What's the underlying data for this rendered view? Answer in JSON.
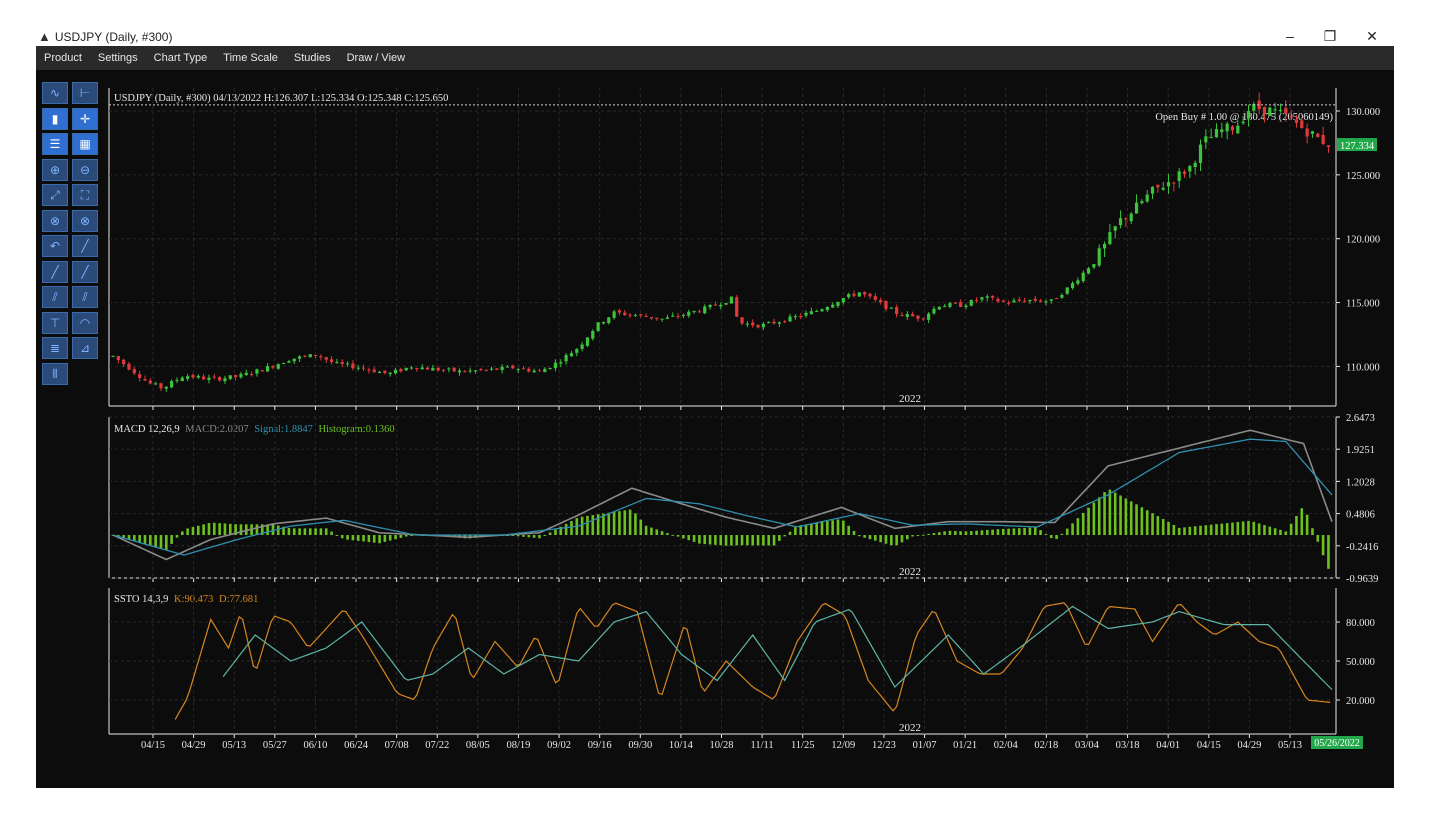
{
  "window": {
    "title": "USDJPY (Daily, #300)",
    "minimize_glyph": "–",
    "restore_glyph": "❐",
    "close_glyph": "✕"
  },
  "menu": [
    "Product",
    "Settings",
    "Chart Type",
    "Time Scale",
    "Studies",
    "Draw / View"
  ],
  "toolbar": {
    "buttons": [
      {
        "icon": "line-chart-icon",
        "active": false
      },
      {
        "icon": "ohlc-bars-icon",
        "active": false
      },
      {
        "icon": "candlestick-icon",
        "active": true
      },
      {
        "icon": "crosshair-icon",
        "active": true
      },
      {
        "icon": "horizontal-lines-icon",
        "active": true
      },
      {
        "icon": "grid-dots-icon",
        "active": true
      },
      {
        "icon": "zoom-in-icon",
        "active": false
      },
      {
        "icon": "zoom-out-icon",
        "active": false
      },
      {
        "icon": "zoom-fit-icon",
        "active": false
      },
      {
        "icon": "fullscreen-icon",
        "active": false
      },
      {
        "icon": "delete-drawing-icon",
        "active": false
      },
      {
        "icon": "delete-all-icon",
        "active": false
      },
      {
        "icon": "undo-icon",
        "active": false
      },
      {
        "icon": "trendline-icon",
        "active": false
      },
      {
        "icon": "ray-icon",
        "active": false
      },
      {
        "icon": "extended-line-icon",
        "active": false
      },
      {
        "icon": "channel-icon",
        "active": false
      },
      {
        "icon": "parallel-lines-icon",
        "active": false
      },
      {
        "icon": "horizontal-ray-icon",
        "active": false
      },
      {
        "icon": "fibonacci-arc-icon",
        "active": false
      },
      {
        "icon": "fibonacci-retracement-icon",
        "active": false
      },
      {
        "icon": "gann-fan-icon",
        "active": false
      },
      {
        "icon": "vertical-lines-icon",
        "active": false
      }
    ]
  },
  "colors": {
    "background": "#0c0c0c",
    "grid": "#2a2a2a",
    "up": "#3cc43c",
    "down": "#e03a3a",
    "macd": "#8a8a8a",
    "signal": "#2f8fb0",
    "histogram": "#6bc21f",
    "stoch_k": "#d7861f",
    "stoch_d": "#5fb5a8",
    "price_tag": "#22a84a"
  },
  "price_panel": {
    "header": "USDJPY (Daily, #300)  04/13/2022 H:126.307 L:125.334 O:125.348 C:125.650",
    "order_label": "Open Buy # 1.00 @ 130.475 (205060149)",
    "order_price": 130.475,
    "last_price_tag": "127.334",
    "last_price": 127.334,
    "year_label": "2022",
    "y_ticks": [
      "130.000",
      "125.000",
      "120.000",
      "115.000",
      "110.000"
    ]
  },
  "macd_panel": {
    "header_name": "MACD 12,26,9",
    "header_macd": "MACD:2.0207",
    "header_signal": "Signal:1.8847",
    "header_hist": "Histogram:0.1360",
    "year_label": "2022",
    "y_ticks": [
      "2.6473",
      "1.9251",
      "1.2028",
      "0.4806",
      "-0.2416",
      "-0.9639"
    ]
  },
  "stoch_panel": {
    "header_name": "SSTO 14,3,9",
    "header_k": "K:90.473",
    "header_d": "D:77.681",
    "year_label": "2022",
    "y_ticks": [
      "80.000",
      "50.000",
      "20.000"
    ]
  },
  "x_axis": {
    "labels": [
      "04/15",
      "04/29",
      "05/13",
      "05/27",
      "06/10",
      "06/24",
      "07/08",
      "07/22",
      "08/05",
      "08/19",
      "09/02",
      "09/16",
      "09/30",
      "10/14",
      "10/28",
      "11/11",
      "11/25",
      "12/09",
      "12/23",
      "01/07",
      "01/21",
      "02/04",
      "02/18",
      "03/04",
      "03/18",
      "04/01",
      "04/15",
      "04/29",
      "05/13"
    ],
    "last_date_tag": "05/26/2022"
  },
  "chart_data": {
    "type": "candlestick",
    "symbol": "USDJPY",
    "timeframe": "Daily",
    "price_series_approx": [
      [
        0,
        110.8
      ],
      [
        10,
        109.8
      ],
      [
        20,
        108.7
      ],
      [
        28,
        108.3
      ],
      [
        40,
        109.3
      ],
      [
        55,
        109.0
      ],
      [
        70,
        109.2
      ],
      [
        85,
        109.8
      ],
      [
        100,
        110.6
      ],
      [
        115,
        110.9
      ],
      [
        125,
        110.2
      ],
      [
        140,
        109.9
      ],
      [
        155,
        109.4
      ],
      [
        168,
        110.0
      ],
      [
        180,
        109.8
      ],
      [
        195,
        109.6
      ],
      [
        210,
        109.7
      ],
      [
        225,
        109.9
      ],
      [
        240,
        109.6
      ],
      [
        250,
        110.3
      ],
      [
        262,
        111.5
      ],
      [
        272,
        113.2
      ],
      [
        282,
        114.2
      ],
      [
        295,
        114.0
      ],
      [
        310,
        113.7
      ],
      [
        322,
        114.1
      ],
      [
        335,
        114.6
      ],
      [
        348,
        115.3
      ],
      [
        352,
        113.4
      ],
      [
        365,
        113.2
      ],
      [
        380,
        113.7
      ],
      [
        395,
        114.3
      ],
      [
        410,
        115.3
      ],
      [
        420,
        115.8
      ],
      [
        432,
        114.9
      ],
      [
        442,
        114.1
      ],
      [
        455,
        113.8
      ],
      [
        465,
        114.8
      ],
      [
        478,
        114.8
      ],
      [
        490,
        115.4
      ],
      [
        502,
        115.0
      ],
      [
        515,
        115.2
      ],
      [
        528,
        115.1
      ],
      [
        538,
        116.2
      ],
      [
        548,
        117.6
      ],
      [
        558,
        119.4
      ],
      [
        566,
        121.3
      ],
      [
        574,
        122.2
      ],
      [
        584,
        123.6
      ],
      [
        596,
        124.6
      ],
      [
        606,
        125.6
      ],
      [
        614,
        127.6
      ],
      [
        624,
        128.5
      ],
      [
        632,
        128.8
      ],
      [
        640,
        130.3
      ],
      [
        650,
        130.1
      ],
      [
        660,
        129.6
      ],
      [
        670,
        128.6
      ],
      [
        680,
        127.7
      ],
      [
        686,
        127.3
      ]
    ],
    "macd_series_approx": {
      "macd": [
        [
          0,
          0.0
        ],
        [
          30,
          -0.55
        ],
        [
          55,
          -0.1
        ],
        [
          90,
          0.25
        ],
        [
          120,
          0.38
        ],
        [
          150,
          0.05
        ],
        [
          200,
          -0.05
        ],
        [
          240,
          0.05
        ],
        [
          262,
          0.45
        ],
        [
          292,
          1.05
        ],
        [
          320,
          0.7
        ],
        [
          345,
          0.4
        ],
        [
          372,
          0.15
        ],
        [
          410,
          0.62
        ],
        [
          440,
          0.15
        ],
        [
          470,
          0.3
        ],
        [
          500,
          0.3
        ],
        [
          530,
          0.28
        ],
        [
          560,
          1.55
        ],
        [
          610,
          2.05
        ],
        [
          640,
          2.35
        ],
        [
          670,
          2.05
        ],
        [
          686,
          0.3
        ]
      ],
      "signal": [
        [
          0,
          0.0
        ],
        [
          40,
          -0.45
        ],
        [
          70,
          -0.1
        ],
        [
          100,
          0.2
        ],
        [
          130,
          0.33
        ],
        [
          170,
          0.0
        ],
        [
          220,
          0.0
        ],
        [
          262,
          0.2
        ],
        [
          300,
          0.82
        ],
        [
          330,
          0.7
        ],
        [
          355,
          0.45
        ],
        [
          385,
          0.18
        ],
        [
          420,
          0.48
        ],
        [
          450,
          0.22
        ],
        [
          480,
          0.25
        ],
        [
          520,
          0.18
        ],
        [
          560,
          0.9
        ],
        [
          600,
          1.85
        ],
        [
          640,
          2.15
        ],
        [
          660,
          2.1
        ],
        [
          686,
          0.9
        ]
      ]
    },
    "stoch_series_approx": {
      "k": [
        [
          35,
          5
        ],
        [
          42,
          22
        ],
        [
          55,
          82
        ],
        [
          65,
          60
        ],
        [
          72,
          88
        ],
        [
          80,
          40
        ],
        [
          90,
          85
        ],
        [
          100,
          80
        ],
        [
          110,
          60
        ],
        [
          120,
          75
        ],
        [
          130,
          90
        ],
        [
          140,
          70
        ],
        [
          160,
          25
        ],
        [
          170,
          20
        ],
        [
          180,
          60
        ],
        [
          192,
          88
        ],
        [
          202,
          35
        ],
        [
          215,
          65
        ],
        [
          228,
          45
        ],
        [
          238,
          70
        ],
        [
          250,
          30
        ],
        [
          262,
          92
        ],
        [
          272,
          75
        ],
        [
          282,
          95
        ],
        [
          295,
          88
        ],
        [
          308,
          20
        ],
        [
          322,
          80
        ],
        [
          332,
          25
        ],
        [
          345,
          50
        ],
        [
          360,
          30
        ],
        [
          372,
          20
        ],
        [
          385,
          65
        ],
        [
          400,
          95
        ],
        [
          412,
          85
        ],
        [
          425,
          35
        ],
        [
          440,
          10
        ],
        [
          452,
          70
        ],
        [
          462,
          90
        ],
        [
          475,
          50
        ],
        [
          488,
          40
        ],
        [
          500,
          40
        ],
        [
          512,
          60
        ],
        [
          524,
          92
        ],
        [
          536,
          95
        ],
        [
          548,
          60
        ],
        [
          560,
          92
        ],
        [
          575,
          90
        ],
        [
          585,
          65
        ],
        [
          600,
          95
        ],
        [
          610,
          80
        ],
        [
          620,
          70
        ],
        [
          633,
          80
        ],
        [
          645,
          65
        ],
        [
          656,
          60
        ],
        [
          672,
          20
        ],
        [
          686,
          18
        ]
      ],
      "d": [
        [
          62,
          38
        ],
        [
          80,
          70
        ],
        [
          100,
          50
        ],
        [
          120,
          60
        ],
        [
          140,
          80
        ],
        [
          165,
          35
        ],
        [
          180,
          40
        ],
        [
          200,
          60
        ],
        [
          220,
          40
        ],
        [
          240,
          55
        ],
        [
          262,
          50
        ],
        [
          282,
          80
        ],
        [
          300,
          88
        ],
        [
          320,
          55
        ],
        [
          340,
          35
        ],
        [
          360,
          70
        ],
        [
          378,
          35
        ],
        [
          395,
          80
        ],
        [
          415,
          90
        ],
        [
          440,
          30
        ],
        [
          470,
          70
        ],
        [
          490,
          40
        ],
        [
          512,
          62
        ],
        [
          540,
          92
        ],
        [
          560,
          75
        ],
        [
          585,
          80
        ],
        [
          600,
          88
        ],
        [
          625,
          78
        ],
        [
          650,
          78
        ],
        [
          670,
          50
        ],
        [
          686,
          28
        ]
      ]
    }
  }
}
